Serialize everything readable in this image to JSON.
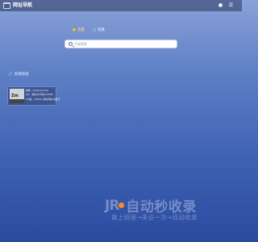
{
  "header": {
    "site_title": "网址导航",
    "icons": [
      "user-icon",
      "menu-icon"
    ]
  },
  "tabs": [
    {
      "label": "百度",
      "active": true
    },
    {
      "label": "谷歌",
      "active": false
    }
  ],
  "search": {
    "placeholder": "百度搜索"
  },
  "section": {
    "title": "友情链接"
  },
  "card": {
    "thumb_text": "Zm",
    "lines": [
      "邮箱：zxx@xxxx.top",
      "QQ：我的QQ号码123456",
      "ICP备：XX2021 网址导航 备案号"
    ]
  },
  "watermark": {
    "brand": "自动秒收录",
    "subtitle": "做上链接→来访一次→自动收录",
    "accent_color": "#ff8a1a"
  }
}
